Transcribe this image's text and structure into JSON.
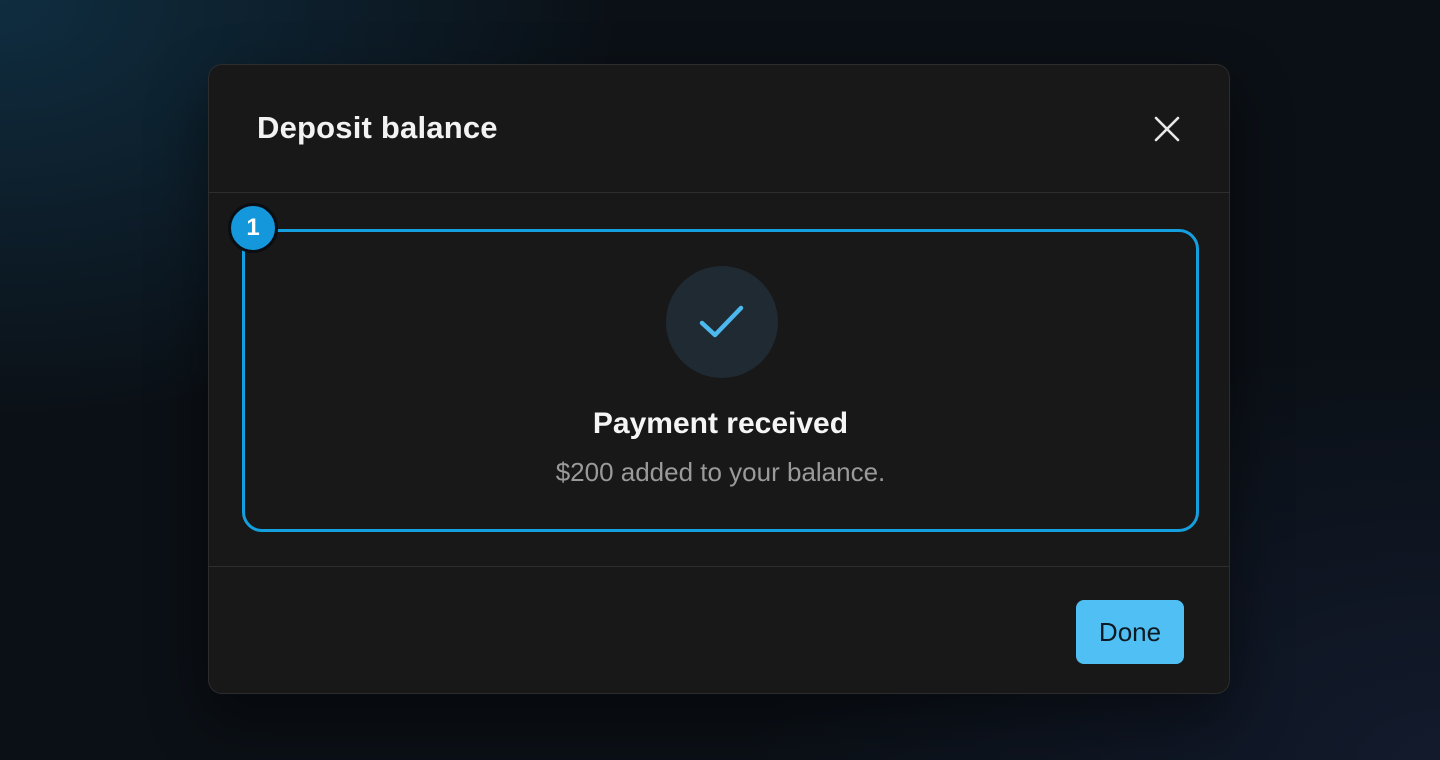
{
  "modal": {
    "title": "Deposit balance",
    "close_icon": "close-icon"
  },
  "annotation": {
    "step_number": "1",
    "highlight_color": "#149fdf"
  },
  "success": {
    "icon": "checkmark-icon",
    "title": "Payment received",
    "message": "$200 added to your balance."
  },
  "footer": {
    "done_label": "Done"
  },
  "colors": {
    "accent": "#4fbff4",
    "check": "#4db8ee",
    "modal_bg": "#181818"
  }
}
